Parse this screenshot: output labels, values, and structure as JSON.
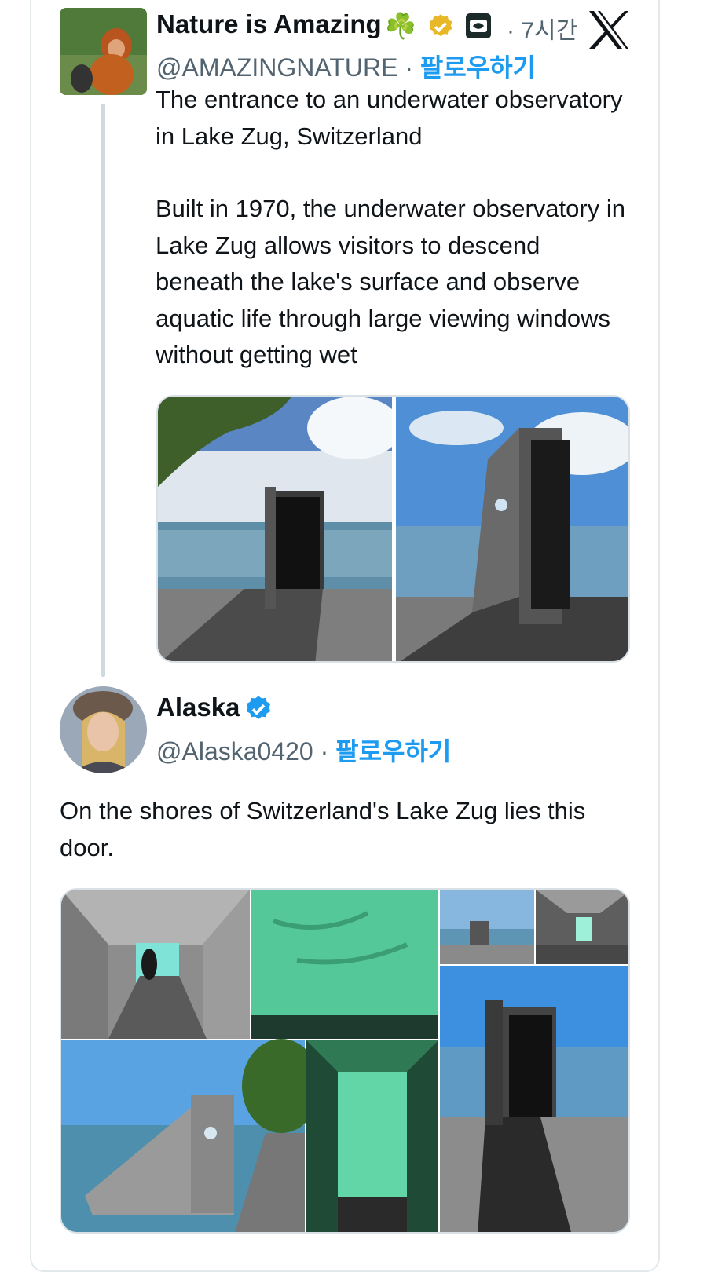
{
  "tweet1": {
    "display_name": "Nature is Amazing",
    "name_emoji": "☘️",
    "handle": "@AMAZINGNATURE",
    "separator": "·",
    "follow_label": "팔로우하기",
    "time_label": "· 7시간",
    "text_line1": "The entrance to an underwater observatory in Lake Zug, Switzerland",
    "text_line2": "Built in 1970, the underwater observatory in Lake Zug allows visitors to descend beneath the lake's surface and observe aquatic life through large viewing windows without getting wet",
    "image_count": 2
  },
  "tweet2": {
    "display_name": "Alaska",
    "handle": "@Alaska0420",
    "separator": "·",
    "follow_label": "팔로우하기",
    "text": "On the shores of Switzerland's Lake Zug lies this door.",
    "image_count": 7
  },
  "icons": {
    "platform": "x-logo-icon",
    "verified_gold": "gold-verified-badge-icon",
    "verified_blue": "blue-verified-badge-icon",
    "affiliate": "affiliate-badge-icon"
  },
  "colors": {
    "follow": "#1d9bf0",
    "secondary_text": "#536471",
    "gold_badge": "#e8b829",
    "blue_badge": "#1d9bf0"
  }
}
